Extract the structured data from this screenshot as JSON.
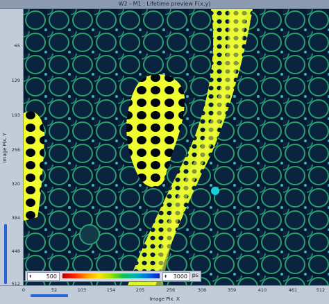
{
  "window": {
    "title": "W2 - M1 : Lifetime preview   F(x,y)"
  },
  "y_axis": {
    "label": "Image Pix. Y",
    "ticks": [
      "65",
      "129",
      "193",
      "256",
      "320",
      "384",
      "448",
      "512"
    ]
  },
  "x_axis": {
    "label": "Image Pix. X",
    "ticks": [
      "0",
      "52",
      "103",
      "154",
      "205",
      "256",
      "308",
      "359",
      "410",
      "461",
      "512"
    ]
  },
  "lut": {
    "min_value": "500",
    "max_value": "3000",
    "unit": "ps"
  },
  "image": {
    "description_colors": {
      "background": "#061a34",
      "cell_wall": "#2fa06a",
      "bright": "#f2ff3a"
    }
  }
}
